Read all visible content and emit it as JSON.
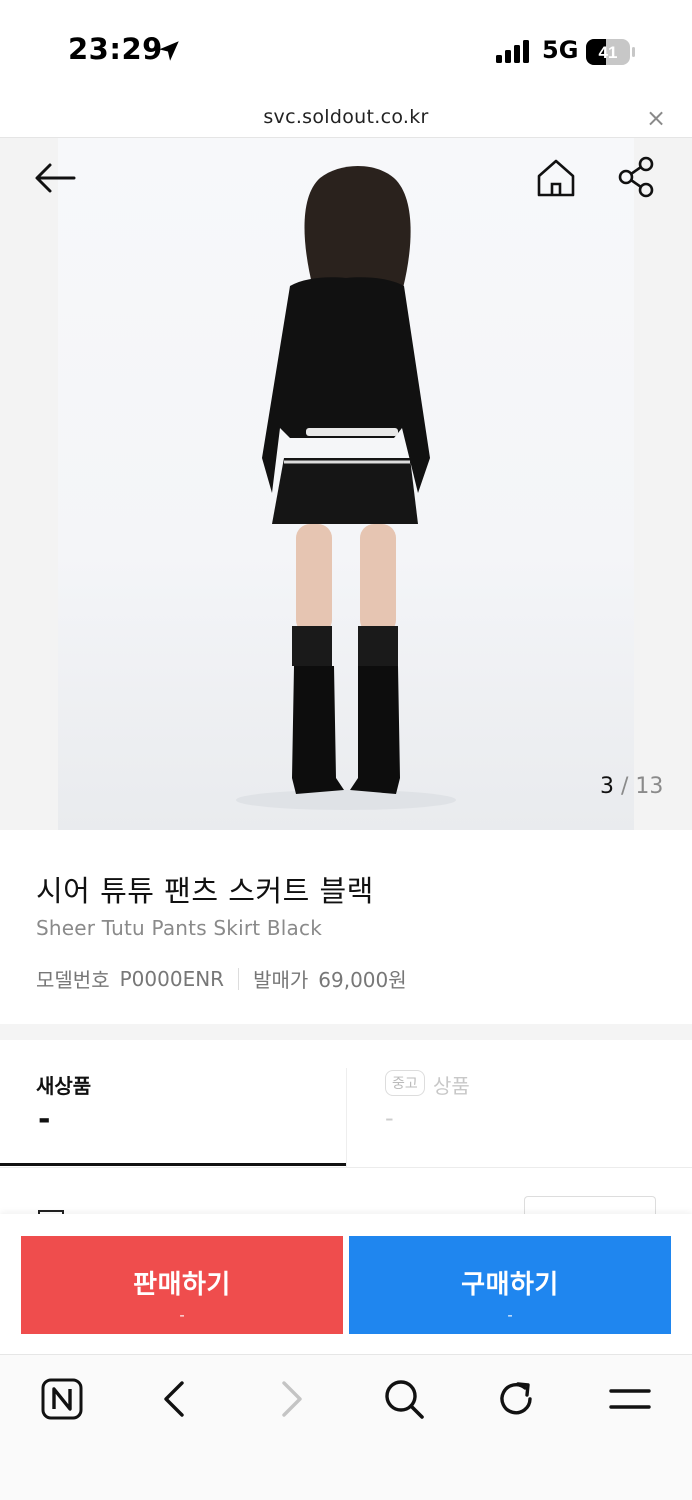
{
  "status_bar": {
    "time": "23:29",
    "network": "5G",
    "battery": "41"
  },
  "url_bar": {
    "url": "svc.soldout.co.kr",
    "close_glyph": "×"
  },
  "gallery": {
    "current": "3",
    "separator": "/",
    "total": "13"
  },
  "product": {
    "name_ko": "시어 튜튜 팬츠 스커트 블랙",
    "name_en": "Sheer Tutu Pants Skirt Black",
    "model_label": "모델번호",
    "model_value": "P0000ENR",
    "release_label": "발매가",
    "release_value": "69,000원"
  },
  "tabs": {
    "new": {
      "title": "새상품",
      "price": "-"
    },
    "used": {
      "badge": "중고",
      "title": "상품",
      "price": "-"
    }
  },
  "actions": {
    "sell": {
      "label": "판매하기",
      "sub": "-"
    },
    "buy": {
      "label": "구매하기",
      "sub": "-"
    }
  },
  "colors": {
    "sell": "#ef4d4d",
    "buy": "#1f86ef"
  },
  "icons": [
    "back-arrow-icon",
    "home-icon",
    "share-icon",
    "naver-icon",
    "chevron-left-icon",
    "chevron-right-icon",
    "search-icon",
    "refresh-icon",
    "menu-icon"
  ]
}
